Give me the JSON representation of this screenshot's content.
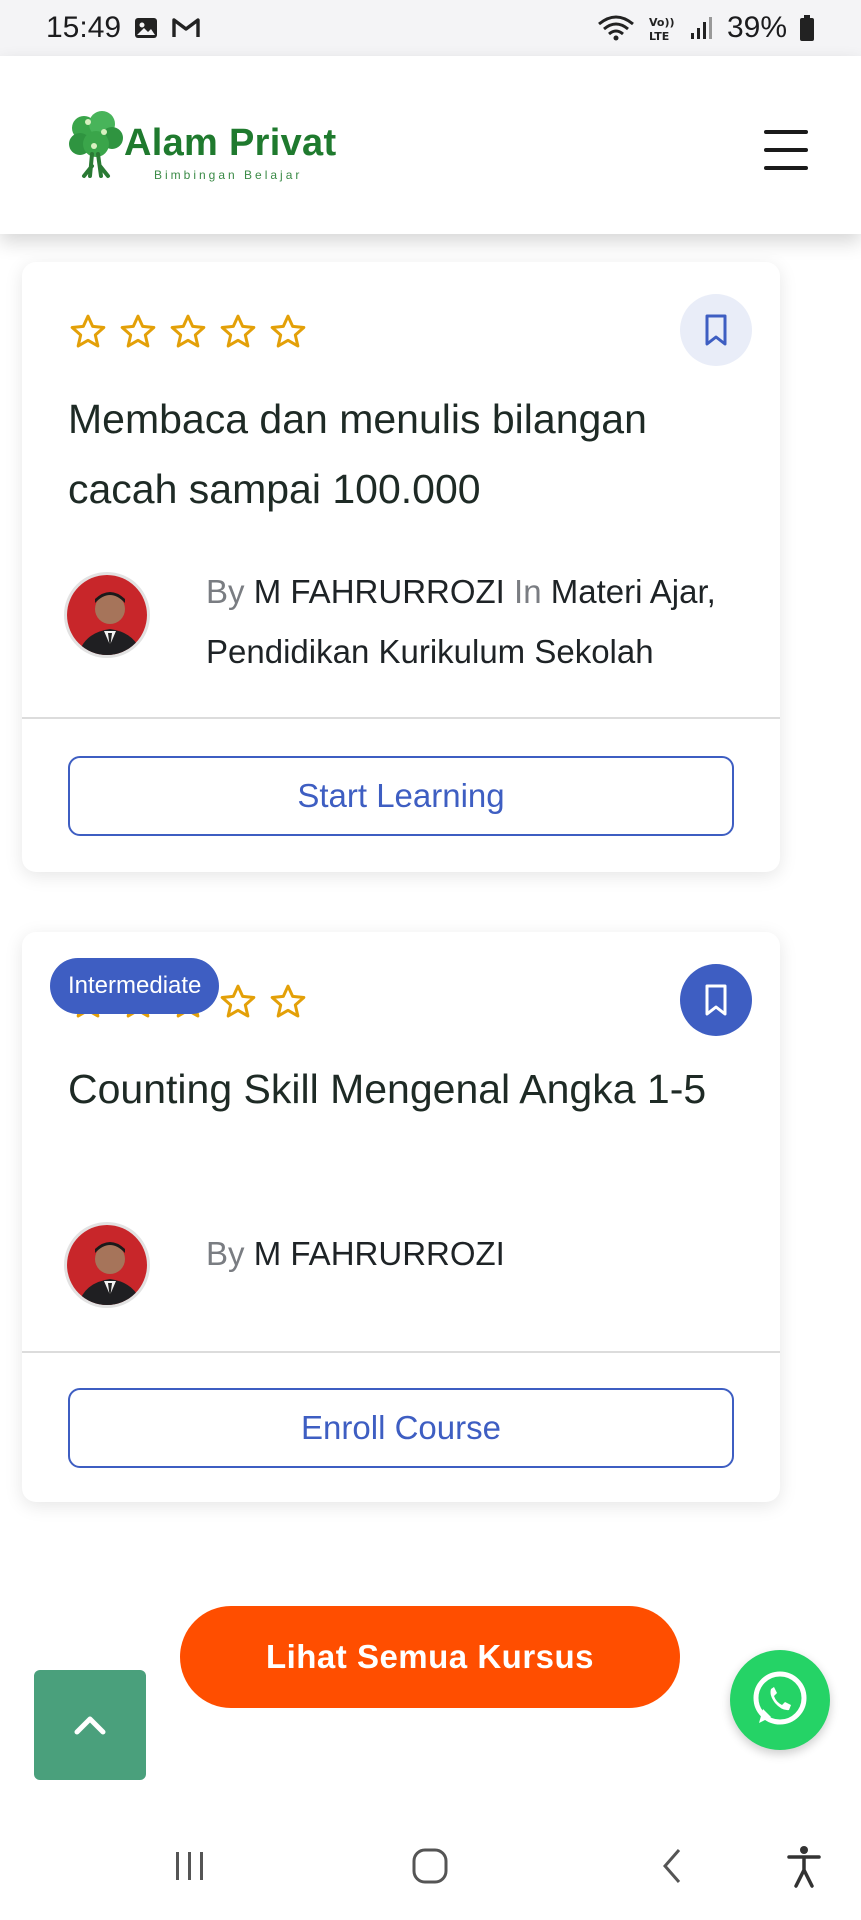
{
  "status_bar": {
    "time": "15:49",
    "battery": "39%",
    "icons": [
      "image-icon",
      "gmail-icon",
      "wifi-icon",
      "volte-icon",
      "signal-icon",
      "battery-icon"
    ]
  },
  "header": {
    "logo_text": "Alam Privat",
    "logo_subtext": "Bimbingan Belajar",
    "logo_icon": "tree-logo-icon",
    "menu_icon": "hamburger-menu-icon"
  },
  "courses": [
    {
      "rating": 0,
      "rating_max": 5,
      "title": "Membaca dan menulis bilangan cacah sampai 100.000",
      "by_label": "By",
      "author": "M FAHRURROZI",
      "in_label": "In",
      "categories": "Materi Ajar, Pendidikan Kurikulum Sekolah",
      "action_label": "Start Learning",
      "bookmarked": false
    },
    {
      "level": "Intermediate",
      "rating": 0,
      "rating_max": 5,
      "title": "Counting Skill Mengenal Angka 1-5",
      "by_label": "By",
      "author": "M FAHRURROZI",
      "action_label": "Enroll Course",
      "bookmarked": true
    }
  ],
  "see_all_label": "Lihat Semua Kursus",
  "colors": {
    "accent": "#3e5ec2",
    "cta": "#ff4e00",
    "back_to_top": "#4aa07c",
    "star": "#e3a008",
    "whatsapp": "#25d366",
    "brand": "#1f7a2e"
  }
}
